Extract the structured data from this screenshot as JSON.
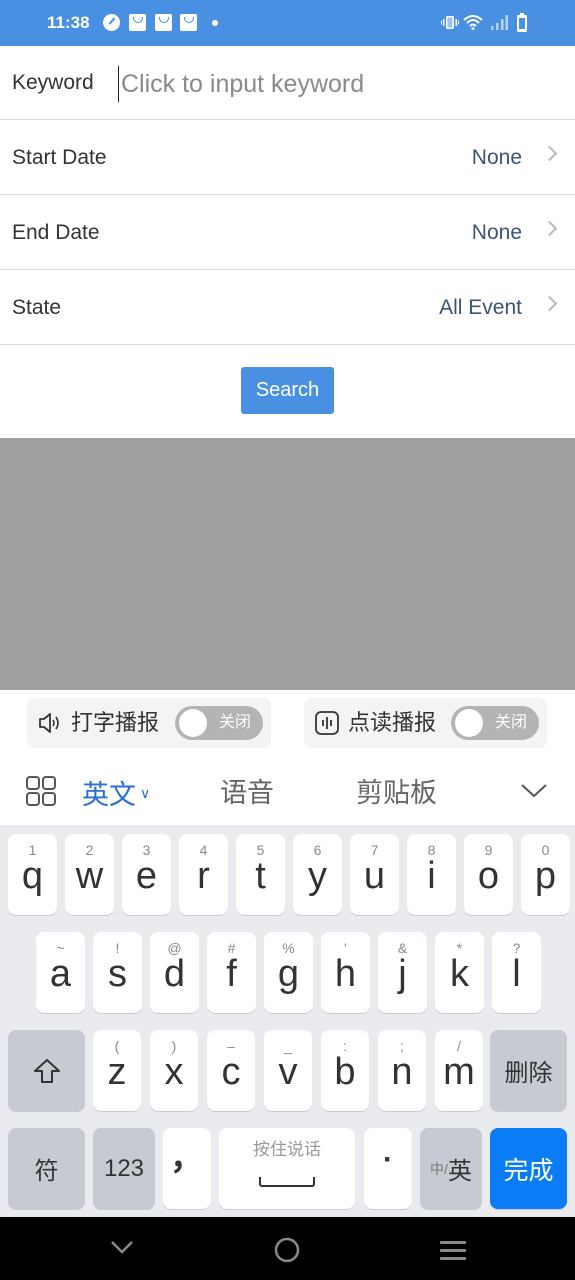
{
  "status_bar": {
    "time": "11:38",
    "icons": [
      "speedometer-icon",
      "shopping-bag-icon",
      "shopping-bag-icon",
      "shopping-bag-icon",
      "dot-icon",
      "vibrate-icon",
      "wifi-icon",
      "signal-icon",
      "battery-icon"
    ],
    "bg_color": "#4a90e2"
  },
  "form": {
    "keyword": {
      "label": "Keyword",
      "value": "",
      "placeholder": "Click to input keyword"
    },
    "start_date": {
      "label": "Start Date",
      "value": "None"
    },
    "end_date": {
      "label": "End Date",
      "value": "None"
    },
    "state": {
      "label": "State",
      "value": "All Event"
    },
    "search_label": "Search",
    "accent_color": "#4a90e2"
  },
  "ime": {
    "typing_broadcast": {
      "label": "打字播报",
      "toggle": "关闭",
      "on": false
    },
    "read_broadcast": {
      "label": "点读播报",
      "toggle": "关闭",
      "on": false
    },
    "tabs": [
      {
        "label": "英文",
        "active": true
      },
      {
        "label": "语音",
        "active": false
      },
      {
        "label": "剪贴板",
        "active": false
      }
    ],
    "active_color": "#2a6fd1"
  },
  "keyboard": {
    "row1": [
      {
        "main": "q",
        "sub": "1"
      },
      {
        "main": "w",
        "sub": "2"
      },
      {
        "main": "e",
        "sub": "3"
      },
      {
        "main": "r",
        "sub": "4"
      },
      {
        "main": "t",
        "sub": "5"
      },
      {
        "main": "y",
        "sub": "6"
      },
      {
        "main": "u",
        "sub": "7"
      },
      {
        "main": "i",
        "sub": "8"
      },
      {
        "main": "o",
        "sub": "9"
      },
      {
        "main": "p",
        "sub": "0"
      }
    ],
    "row2": [
      {
        "main": "a",
        "sub": "~"
      },
      {
        "main": "s",
        "sub": "!"
      },
      {
        "main": "d",
        "sub": "@"
      },
      {
        "main": "f",
        "sub": "#"
      },
      {
        "main": "g",
        "sub": "%"
      },
      {
        "main": "h",
        "sub": "'"
      },
      {
        "main": "j",
        "sub": "&"
      },
      {
        "main": "k",
        "sub": "*"
      },
      {
        "main": "l",
        "sub": "?"
      }
    ],
    "row3": [
      {
        "main": "z",
        "sub": "("
      },
      {
        "main": "x",
        "sub": ")"
      },
      {
        "main": "c",
        "sub": "–"
      },
      {
        "main": "v",
        "sub": "_"
      },
      {
        "main": "b",
        "sub": ":"
      },
      {
        "main": "n",
        "sub": ";"
      },
      {
        "main": "m",
        "sub": "/"
      }
    ],
    "delete_label": "删除",
    "symbol_label": "符",
    "numbers_label": "123",
    "comma": "，",
    "space_hint": "按住说话",
    "period": "·",
    "lang_switch_small": "中/",
    "lang_switch_big": "英",
    "done_label": "完成",
    "done_color": "#0a7cf5"
  },
  "nav_bar": {
    "icons": [
      "back-chevron-icon",
      "home-circle-icon",
      "menu-icon"
    ]
  }
}
